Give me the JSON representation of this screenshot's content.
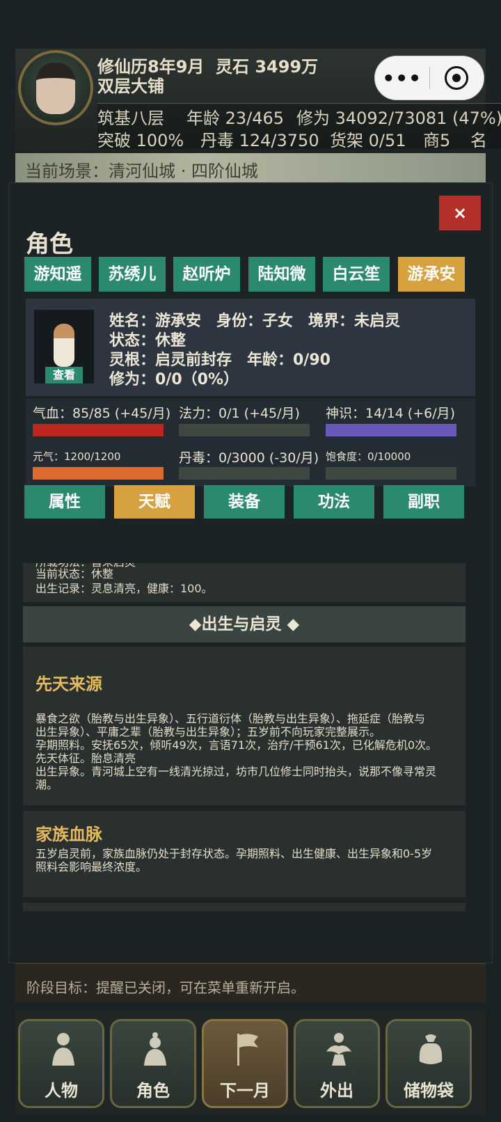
{
  "header": {
    "calendar": "修仙历8年9月",
    "spirit_stones": "灵石 3499万",
    "shop": "双层大铺",
    "realm": "筑基八层",
    "age": "年龄 23/465",
    "cultivation": "修为 34092/73081 (47%)",
    "breakthrough": "突破 100%",
    "pill_toxin": "丹毒 124/3750",
    "shelf": "货架 0/51",
    "merchant": "商5",
    "fame": "名",
    "capsule_more": "•••",
    "scene": "当前场景：清河仙城 · 四阶仙城",
    "goal": "阶段目标：提醒已关闭，可在菜单重新开启。"
  },
  "modal": {
    "close": "×",
    "title": "角色",
    "characters": [
      "游知遥",
      "苏绣儿",
      "赵听炉",
      "陆知微",
      "白云笙",
      "游承安"
    ],
    "selected_character": 5,
    "info": {
      "line1": "姓名：游承安　身份：子女　境界：未启灵",
      "line2": "状态：休整",
      "line3": "灵根：启灵前封存　年龄：0/90",
      "line4": "修为：0/0（0%）",
      "view": "查看"
    },
    "stats": [
      {
        "label": "气血：85/85 (+45/月)",
        "fill": 1.0,
        "color": "#c0241f"
      },
      {
        "label": "法力：0/1 (+45/月)",
        "fill": 0.0,
        "color": "#3e4740"
      },
      {
        "label": "神识：14/14 (+6/月)",
        "fill": 1.0,
        "color": "#6a58b8"
      },
      {
        "label": "元气：1200/1200",
        "fill": 1.0,
        "color": "#dd6a2e"
      },
      {
        "label": "丹毒：0/3000 (-30/月)",
        "fill": 0.0,
        "color": "#3e4740"
      },
      {
        "label": "饱食度：0/10000",
        "fill": 0.0,
        "color": "#3e4740"
      }
    ],
    "subtabs": [
      "属性",
      "天赋",
      "装备",
      "功法",
      "副职"
    ],
    "selected_subtab": 1,
    "content": {
      "cut_line": "所载功法：暂未启灵",
      "state_line": "当前状态：休整",
      "birth_line": "出生记录：灵息清亮，健康：100。",
      "section_title": "◆出生与启灵 ◆",
      "innate_title": "先天来源",
      "innate_lines": [
        "暴食之欲（胎教与出生异象）、五行道衍体（胎教与出生异象）、拖延症（胎教与",
        "出生异象）、平庸之辈（胎教与出生异象）；五岁前不向玩家完整展示。",
        "孕期照料。安抚65次，倾听49次，言语71次，治疗/干预61次，已化解危机0次。",
        "先天体征。胎息清亮",
        "出生异象。青河城上空有一线清光掠过，坊市几位修士同时抬头，说那不像寻常灵",
        "潮。"
      ],
      "bloodline_title": "家族血脉",
      "bloodline_lines": [
        "五岁启灵前，家族血脉仍处于封存状态。孕期照料、出生健康、出生异象和0-5岁",
        "照料会影响最终浓度。"
      ]
    }
  },
  "nav": [
    {
      "label": "人物",
      "icon": "person-icon"
    },
    {
      "label": "角色",
      "icon": "role-icon"
    },
    {
      "label": "下一月",
      "icon": "flag-icon"
    },
    {
      "label": "外出",
      "icon": "travel-icon"
    },
    {
      "label": "储物袋",
      "icon": "bag-icon"
    }
  ],
  "nav_selected": 2
}
